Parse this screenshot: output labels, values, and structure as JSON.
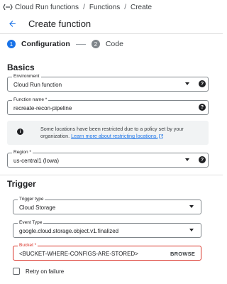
{
  "breadcrumb": {
    "items": [
      "Cloud Run functions",
      "Functions",
      "Create"
    ],
    "separator": "/"
  },
  "header": {
    "title": "Create function"
  },
  "stepper": {
    "steps": [
      {
        "number": "1",
        "label": "Configuration",
        "active": true
      },
      {
        "number": "2",
        "label": "Code",
        "active": false
      }
    ]
  },
  "basics": {
    "title": "Basics",
    "environment": {
      "label": "Environment",
      "value": "Cloud Run function"
    },
    "function_name": {
      "label": "Function name *",
      "value": "recreate-recon-pipeline"
    },
    "policy_notice": {
      "text": "Some locations have been restricted due to a policy set by your organization.",
      "link": "Learn more about restricting locations."
    },
    "region": {
      "label": "Region *",
      "value": "us-central1 (Iowa)"
    }
  },
  "trigger": {
    "title": "Trigger",
    "trigger_type": {
      "label": "Trigger type",
      "value": "Cloud Storage"
    },
    "event_type": {
      "label": "Event Type",
      "value": "google.cloud.storage.object.v1.finalized"
    },
    "bucket": {
      "label": "Bucket *",
      "value": "<BUCKET-WHERE-CONFIGS-ARE-STORED>",
      "action": "BROWSE"
    },
    "retry": {
      "label": "Retry on failure",
      "checked": false
    }
  },
  "icons": {
    "help": "?",
    "info": "i"
  },
  "colors": {
    "accent": "#1a73e8",
    "error": "#d93025",
    "step_inactive": "#80868b"
  }
}
